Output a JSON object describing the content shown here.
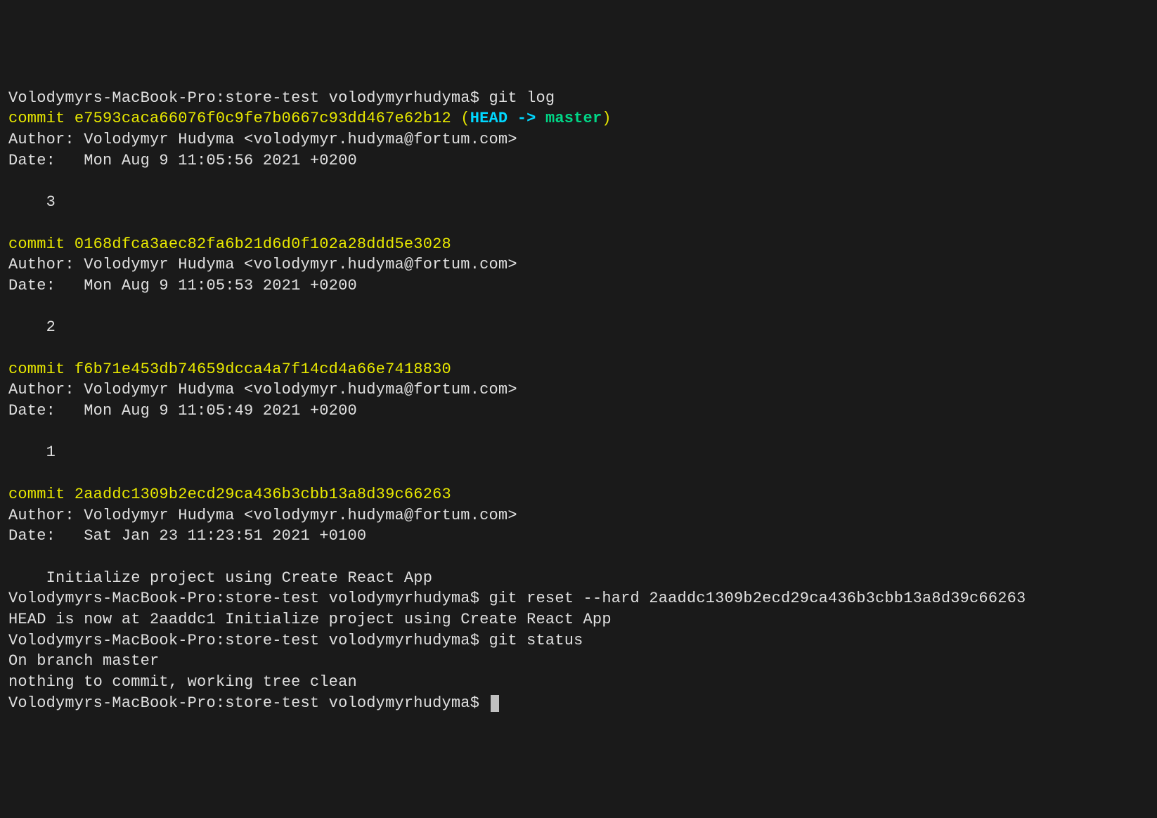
{
  "prompt": "Volodymyrs-MacBook-Pro:store-test volodymyrhudyma$ ",
  "commands": {
    "cmd1": "git log",
    "cmd2": "git reset --hard 2aaddc1309b2ecd29ca436b3cbb13a8d39c66263",
    "cmd3": "git status"
  },
  "commits": [
    {
      "line": "commit e7593caca66076f0c9fe7b0667c93dd467e62b12",
      "ref_open": " (",
      "head": "HEAD -> ",
      "branch": "master",
      "ref_close": ")",
      "author": "Author: Volodymyr Hudyma <volodymyr.hudyma@fortum.com>",
      "date": "Date:   Mon Aug 9 11:05:56 2021 +0200",
      "message": "    3"
    },
    {
      "line": "commit 0168dfca3aec82fa6b21d6d0f102a28ddd5e3028",
      "author": "Author: Volodymyr Hudyma <volodymyr.hudyma@fortum.com>",
      "date": "Date:   Mon Aug 9 11:05:53 2021 +0200",
      "message": "    2"
    },
    {
      "line": "commit f6b71e453db74659dcca4a7f14cd4a66e7418830",
      "author": "Author: Volodymyr Hudyma <volodymyr.hudyma@fortum.com>",
      "date": "Date:   Mon Aug 9 11:05:49 2021 +0200",
      "message": "    1"
    },
    {
      "line": "commit 2aaddc1309b2ecd29ca436b3cbb13a8d39c66263",
      "author": "Author: Volodymyr Hudyma <volodymyr.hudyma@fortum.com>",
      "date": "Date:   Sat Jan 23 11:23:51 2021 +0100",
      "message": "    Initialize project using Create React App"
    }
  ],
  "reset_output": "HEAD is now at 2aaddc1 Initialize project using Create React App",
  "status_output": {
    "line1": "On branch master",
    "line2": "nothing to commit, working tree clean"
  }
}
